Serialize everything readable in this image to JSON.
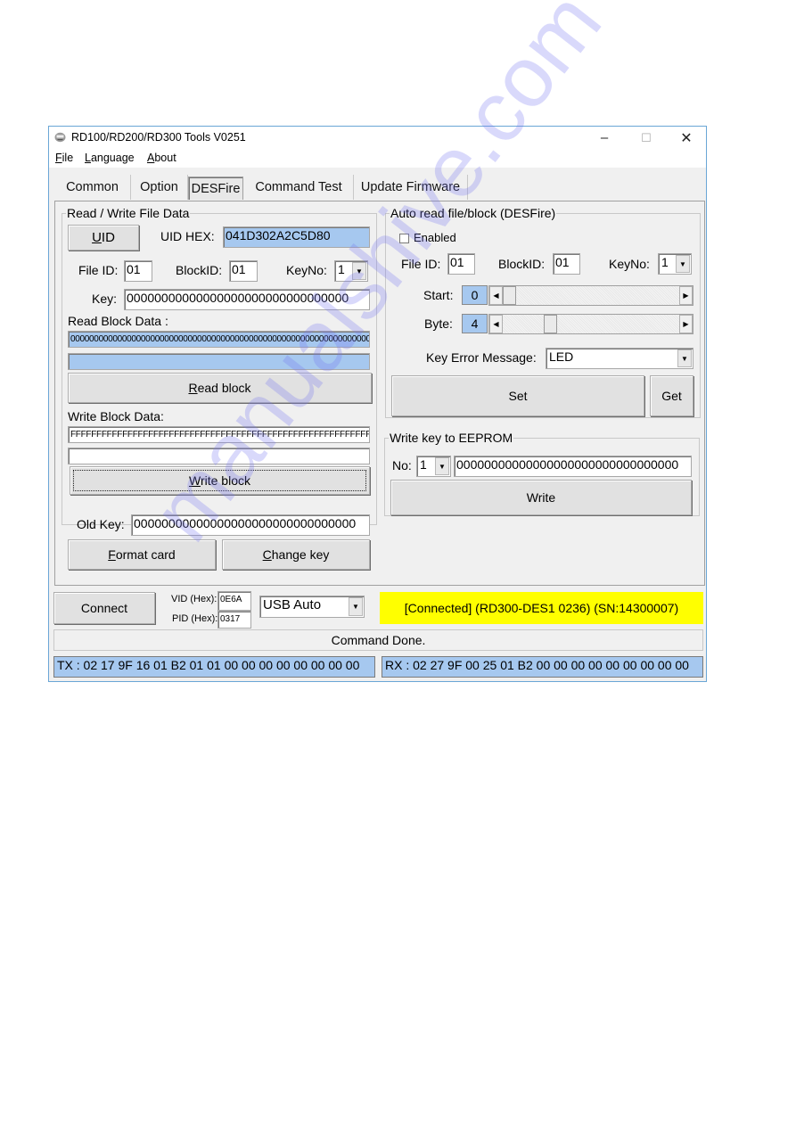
{
  "window": {
    "title": "RD100/RD200/RD300 Tools V0251",
    "controls": {
      "minimize": "–",
      "maximize": "☐",
      "close": "✕"
    }
  },
  "menu": {
    "items": [
      {
        "label": "File",
        "mnemonic": "F"
      },
      {
        "label": "Language",
        "mnemonic": "L"
      },
      {
        "label": "About",
        "mnemonic": "A"
      }
    ]
  },
  "tabs": [
    {
      "label": "Common",
      "active": false
    },
    {
      "label": "Option",
      "active": false
    },
    {
      "label": "DESFire",
      "active": true
    },
    {
      "label": "Command Test",
      "active": false
    },
    {
      "label": "Update Firmware",
      "active": false
    }
  ],
  "rw_group": {
    "legend": "Read / Write File Data",
    "uid_button": "UID",
    "uid_hex_label": "UID HEX:",
    "uid_hex_value": "041D302A2C5D80",
    "file_id_label": "File ID:",
    "file_id_value": "01",
    "block_id_label": "BlockID:",
    "block_id_value": "01",
    "key_no_label": "KeyNo:",
    "key_no_value": "1",
    "key_label": "Key:",
    "key_value": "00000000000000000000000000000000",
    "read_block_data_label": "Read Block Data :",
    "read_block_data_value": "0000000000000000000000000000000000000000000000000000000000000000",
    "read_block_data_value2": "",
    "read_block_button": "Read block",
    "write_block_data_label": "Write Block Data:",
    "write_block_data_value": "FFFFFFFFFFFFFFFFFFFFFFFFFFFFFFFFFFFFFFFFFFFFFFFFFFFFFFFFFFFFFFFF",
    "write_block_data_value2": "",
    "write_block_button": "Write block",
    "old_key_label": "Old Key:",
    "old_key_value": "00000000000000000000000000000000",
    "format_card_button": "Format card",
    "change_key_button": "Change key"
  },
  "auto_group": {
    "legend": "Auto read file/block (DESFire)",
    "enabled_label": "Enabled",
    "enabled_checked": false,
    "file_id_label": "File ID:",
    "file_id_value": "01",
    "block_id_label": "BlockID:",
    "block_id_value": "01",
    "key_no_label": "KeyNo:",
    "key_no_value": "1",
    "start_label": "Start:",
    "start_value": "0",
    "byte_label": "Byte:",
    "byte_value": "4",
    "key_error_label": "Key Error Message:",
    "key_error_value": "LED",
    "set_button": "Set",
    "get_button": "Get"
  },
  "eeprom_group": {
    "legend": "Write key to EEPROM",
    "no_label": "No:",
    "no_value": "1",
    "key_value": "00000000000000000000000000000000",
    "write_button": "Write"
  },
  "connection": {
    "connect_button": "Connect",
    "vid_label": "VID (Hex):",
    "vid_value": "0E6A",
    "pid_label": "PID (Hex):",
    "pid_value": "0317",
    "port_value": "USB Auto",
    "status": "[Connected] (RD300-DES1  0236) (SN:14300007)",
    "status_color": "#ffff00"
  },
  "statusbar": {
    "message": "Command Done.",
    "tx": "TX : 02 17 9F 16 01 B2 01 01 00 00 00 00 00 00 00 00",
    "rx": "RX : 02 27 9F 00 25 01 B2 00 00 00 00 00 00 00 00 00"
  },
  "colors": {
    "selection": "#a6c8ef",
    "window_border": "#6aa6d6",
    "connected_bg": "#ffff00"
  },
  "watermark": "manualshive.com"
}
